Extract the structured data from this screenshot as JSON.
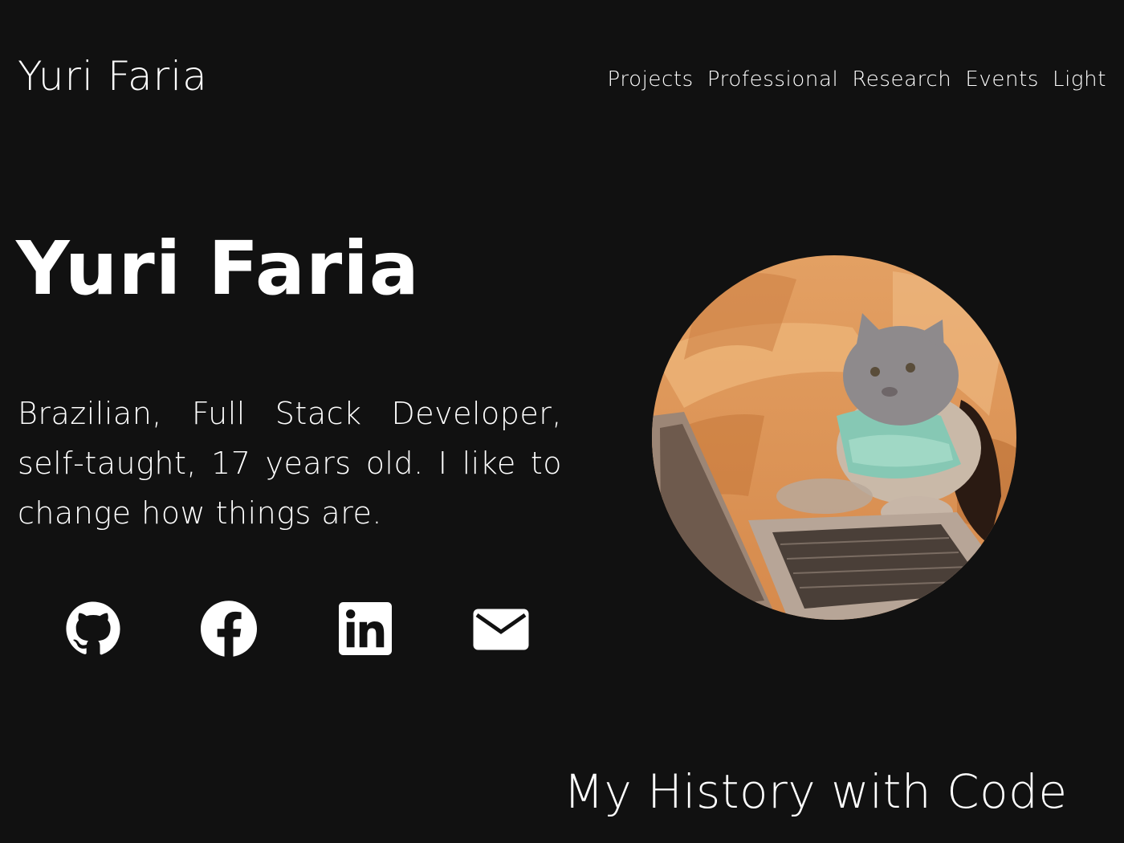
{
  "header": {
    "brand": "Yuri Faria",
    "nav": [
      {
        "label": "Projects"
      },
      {
        "label": "Professional"
      },
      {
        "label": "Research"
      },
      {
        "label": "Events"
      },
      {
        "label": "Light"
      }
    ]
  },
  "hero": {
    "title": "Yuri Faria",
    "description": "Brazilian, Full Stack Developer, self-taught, 17 years old. I like to change how things are.",
    "socials": [
      {
        "icon": "github-icon"
      },
      {
        "icon": "facebook-icon"
      },
      {
        "icon": "linkedin-icon"
      },
      {
        "icon": "email-icon"
      }
    ]
  },
  "next_section": {
    "heading": "My History with Code"
  },
  "colors": {
    "background": "#111111",
    "text": "#ffffff"
  }
}
